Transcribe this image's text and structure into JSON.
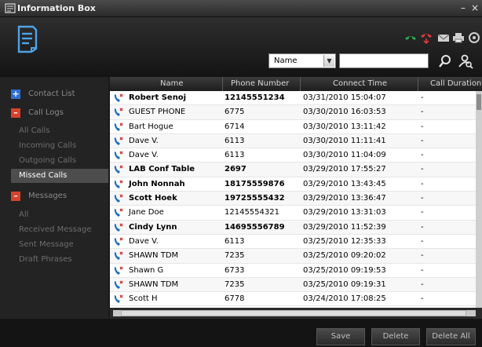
{
  "window": {
    "title": "Information Box",
    "minimize": "–",
    "close": "×"
  },
  "search": {
    "field": "Name",
    "value": ""
  },
  "sidebar": {
    "contact_list": {
      "sign": "+",
      "label": "Contact List"
    },
    "call_logs": {
      "sign": "–",
      "label": "Call Logs"
    },
    "call_items": [
      "All Calls",
      "Incoming Calls",
      "Outgoing Calls",
      "Missed Calls"
    ],
    "messages": {
      "sign": "–",
      "label": "Messages"
    },
    "message_items": [
      "All",
      "Received Message",
      "Sent Message",
      "Draft Phrases"
    ]
  },
  "table": {
    "columns": [
      "Name",
      "Phone Number",
      "Connect Time",
      "Call Duration"
    ],
    "rows": [
      {
        "name": "Robert Senoj",
        "phone": "12145551234",
        "time": "03/31/2010 15:04:07",
        "duration": "-",
        "bold": true
      },
      {
        "name": "GUEST PHONE",
        "phone": "6775",
        "time": "03/30/2010 16:03:53",
        "duration": "-",
        "bold": false
      },
      {
        "name": "Bart Hogue",
        "phone": "6714",
        "time": "03/30/2010 13:11:42",
        "duration": "-",
        "bold": false
      },
      {
        "name": "Dave V.",
        "phone": "6113",
        "time": "03/30/2010 11:11:41",
        "duration": "-",
        "bold": false
      },
      {
        "name": "Dave V.",
        "phone": "6113",
        "time": "03/30/2010 11:04:09",
        "duration": "-",
        "bold": false
      },
      {
        "name": "LAB Conf Table",
        "phone": "2697",
        "time": "03/29/2010 17:55:27",
        "duration": "-",
        "bold": true
      },
      {
        "name": "John Nonnah",
        "phone": "18175559876",
        "time": "03/29/2010 13:43:45",
        "duration": "-",
        "bold": true
      },
      {
        "name": "Scott Hoek",
        "phone": "19725555432",
        "time": "03/29/2010 13:36:47",
        "duration": "-",
        "bold": true
      },
      {
        "name": "Jane Doe",
        "phone": "12145554321",
        "time": "03/29/2010 13:31:03",
        "duration": "-",
        "bold": false
      },
      {
        "name": "Cindy Lynn",
        "phone": "14695556789",
        "time": "03/29/2010 11:52:39",
        "duration": "-",
        "bold": true
      },
      {
        "name": "Dave V.",
        "phone": "6113",
        "time": "03/25/2010 12:35:33",
        "duration": "-",
        "bold": false
      },
      {
        "name": "SHAWN TDM",
        "phone": "7235",
        "time": "03/25/2010 09:20:02",
        "duration": "-",
        "bold": false
      },
      {
        "name": "Shawn G",
        "phone": "6733",
        "time": "03/25/2010 09:19:53",
        "duration": "-",
        "bold": false
      },
      {
        "name": "SHAWN TDM",
        "phone": "7235",
        "time": "03/25/2010 09:19:31",
        "duration": "-",
        "bold": false
      },
      {
        "name": "Scott H",
        "phone": "6778",
        "time": "03/24/2010 17:08:25",
        "duration": "-",
        "bold": false
      }
    ]
  },
  "footer": {
    "save": "Save",
    "delete": "Delete",
    "delete_all": "Delete All"
  },
  "icons": {
    "app": "window-icon",
    "logo": "notepad-logo-icon",
    "answer": "phone-answer-icon",
    "hangup": "phone-hangup-icon",
    "mail": "envelope-icon",
    "print": "printer-icon",
    "settings": "settings-icon",
    "search": "magnifier-icon",
    "person_search": "person-search-icon",
    "missed_call": "missed-call-icon"
  },
  "colors": {
    "answer": "#2fa84f",
    "hangup": "#e03a3a",
    "missed": "#1f6fbf",
    "active_item": "#4d4d4d"
  }
}
